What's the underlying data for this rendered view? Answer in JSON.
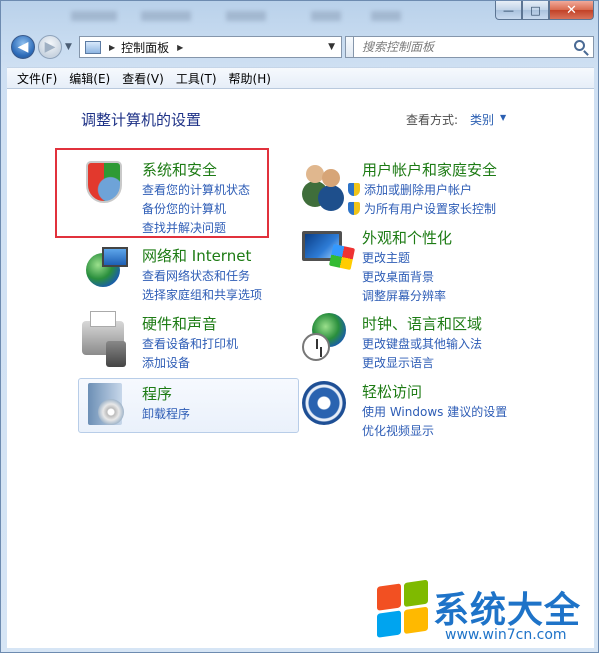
{
  "window": {
    "buttons": {
      "minimize": "—",
      "maximize": "□",
      "close": "✕"
    }
  },
  "nav": {
    "back_label": "◀",
    "forward_label": "▶",
    "history_dropdown": "▼",
    "address": {
      "separator": "▶",
      "location": "控制面板",
      "separator2": "▶",
      "dropdown": "▼"
    },
    "refresh_label": "⇆",
    "search_placeholder": "搜索控制面板"
  },
  "menu": [
    "文件(F)",
    "编辑(E)",
    "查看(V)",
    "工具(T)",
    "帮助(H)"
  ],
  "content": {
    "heading": "调整计算机的设置",
    "view_by_label": "查看方式:",
    "view_by_value": "类别",
    "view_by_arrow": "▼",
    "categories": [
      {
        "title": "系统和安全",
        "icon": "shield-icon",
        "links": [
          "查看您的计算机状态",
          "备份您的计算机",
          "查找并解决问题"
        ]
      },
      {
        "title": "网络和 Internet",
        "icon": "network-icon",
        "links": [
          "查看网络状态和任务",
          "选择家庭组和共享选项"
        ]
      },
      {
        "title": "硬件和声音",
        "icon": "printer-icon",
        "links": [
          "查看设备和打印机",
          "添加设备"
        ]
      },
      {
        "title": "程序",
        "icon": "programs-icon",
        "links": [
          "卸载程序"
        ]
      },
      {
        "title": "用户帐户和家庭安全",
        "icon": "users-icon",
        "links": [
          "添加或删除用户帐户",
          "为所有用户设置家长控制"
        ]
      },
      {
        "title": "外观和个性化",
        "icon": "appearance-icon",
        "links": [
          "更改主题",
          "更改桌面背景",
          "调整屏幕分辨率"
        ]
      },
      {
        "title": "时钟、语言和区域",
        "icon": "clock-globe-icon",
        "links": [
          "更改键盘或其他输入法",
          "更改显示语言"
        ]
      },
      {
        "title": "轻松访问",
        "icon": "ease-of-access-icon",
        "links": [
          "使用 Windows 建议的设置",
          "优化视频显示"
        ]
      }
    ]
  },
  "watermark": {
    "title": "系统大全",
    "url": "www.win7cn.com"
  },
  "colors": {
    "link": "#2e5db6",
    "category_title": "#1d7b14",
    "heading": "#1e3287",
    "highlight": "#e1313c"
  }
}
